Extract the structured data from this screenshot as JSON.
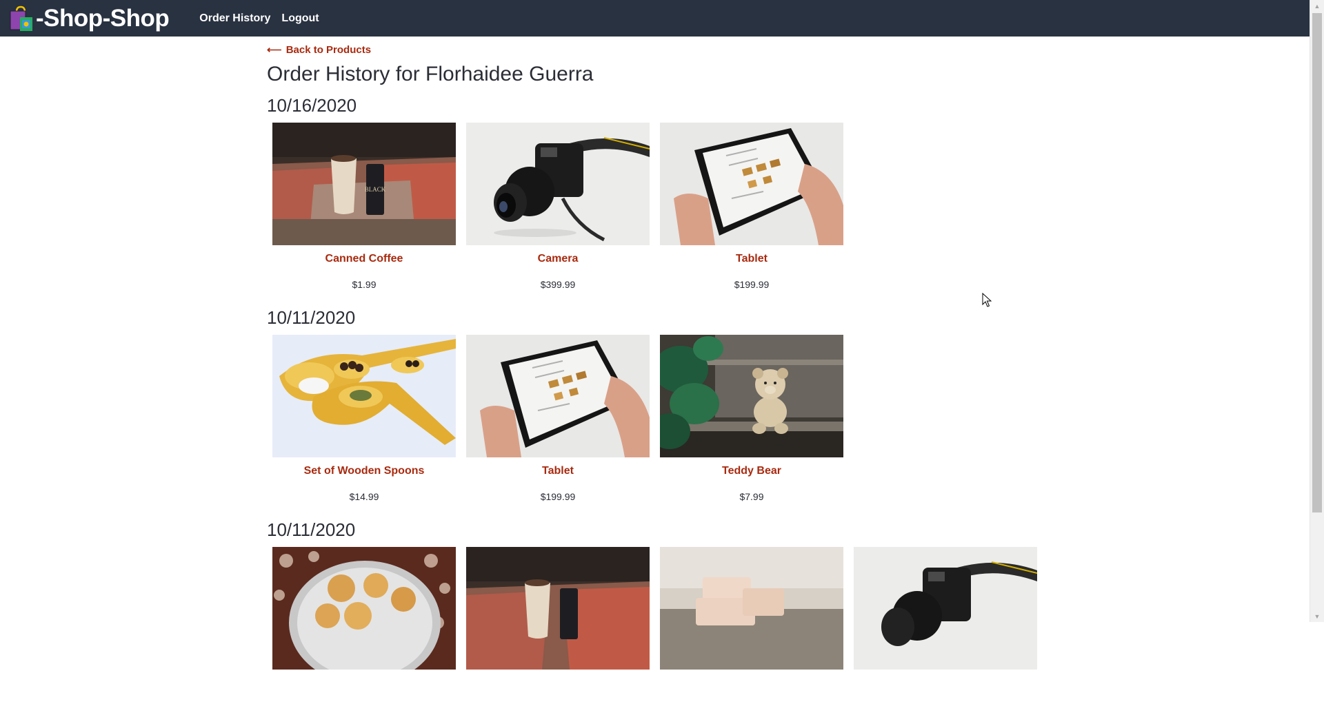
{
  "app": {
    "brand": "-Shop-Shop",
    "nav": [
      {
        "label": "Order History"
      },
      {
        "label": "Logout"
      }
    ]
  },
  "page": {
    "back_arrow": "⟵",
    "back_label": "Back to Products",
    "title": "Order History for Florhaidee Guerra"
  },
  "orders": [
    {
      "date": "10/16/2020",
      "items": [
        {
          "name": "Canned Coffee",
          "price": "$1.99"
        },
        {
          "name": "Camera",
          "price": "$399.99"
        },
        {
          "name": "Tablet",
          "price": "$199.99"
        }
      ]
    },
    {
      "date": "10/11/2020",
      "items": [
        {
          "name": "Set of Wooden Spoons",
          "price": "$14.99"
        },
        {
          "name": "Tablet",
          "price": "$199.99"
        },
        {
          "name": "Teddy Bear",
          "price": "$7.99"
        }
      ]
    },
    {
      "date": "10/11/2020",
      "items": [
        {
          "name": "",
          "price": ""
        },
        {
          "name": "",
          "price": ""
        },
        {
          "name": "",
          "price": ""
        },
        {
          "name": "",
          "price": ""
        }
      ]
    }
  ],
  "colors": {
    "header_bg": "#293241",
    "accent": "#a82a0f",
    "text": "#2b2d36"
  },
  "icons": {
    "brand": "shopping-bag-icon",
    "cursor": "mouse-pointer-icon"
  }
}
